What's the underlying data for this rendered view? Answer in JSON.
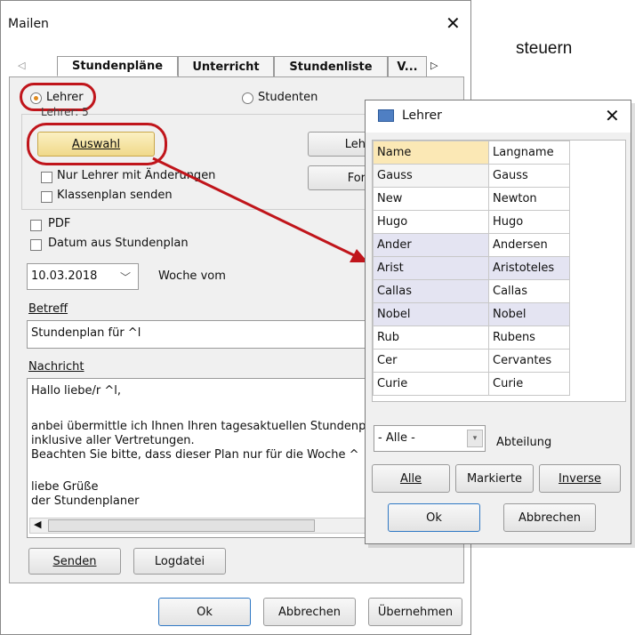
{
  "annotation": {
    "text": "steuern"
  },
  "main_window": {
    "title": "Mailen",
    "tabs": [
      "Stundenpläne",
      "Unterricht",
      "Stundenliste",
      "V..."
    ],
    "radio_teacher": "Lehrer",
    "radio_students": "Studenten",
    "teacher_count": "Lehrer: 5",
    "select_button": "Auswahl",
    "right_button_1": "Leh",
    "right_button_2": "For",
    "cb_only_changes": "Nur Lehrer mit Änderungen",
    "cb_send_class": "Klassenplan senden",
    "cb_pdf": "PDF",
    "cb_date_from_plan": "Datum aus Stundenplan",
    "date_value": "10.03.2018",
    "week_label": "Woche vom",
    "subject_label": "Betreff",
    "subject_value": "Stundenplan für ^l",
    "message_label": "Nachricht",
    "message_lines": [
      "Hallo liebe/r  ^l,",
      "",
      "anbei übermittle ich Ihnen Ihren tagesaktuellen Stundenp",
      "inklusive aller Vertretungen.",
      "Beachten Sie bitte, dass dieser Plan nur für die Woche ^",
      "",
      "liebe Grüße",
      "der Stundenplaner"
    ],
    "send_button": "Senden",
    "logfile_button": "Logdatei",
    "ok_button": "Ok",
    "cancel_button": "Abbrechen",
    "apply_button": "Übernehmen"
  },
  "teacher_dialog": {
    "title": "Lehrer",
    "columns": [
      "Name",
      "Langname"
    ],
    "rows": [
      [
        "Gauss",
        "Gauss"
      ],
      [
        "New",
        "Newton"
      ],
      [
        "Hugo",
        "Hugo"
      ],
      [
        "Ander",
        "Andersen"
      ],
      [
        "Arist",
        "Aristoteles"
      ],
      [
        "Callas",
        "Callas"
      ],
      [
        "Nobel",
        "Nobel"
      ],
      [
        "Rub",
        "Rubens"
      ],
      [
        "Cer",
        "Cervantes"
      ],
      [
        "Curie",
        "Curie"
      ]
    ],
    "filter_value": "- Alle -",
    "filter_label": "Abteilung",
    "all_button": "Alle",
    "marked_button": "Markierte",
    "inverse_button": "Inverse",
    "ok_button": "Ok",
    "cancel_button": "Abbrechen"
  },
  "colors": {
    "highlight_red": "#c0151b",
    "select_button_yellow": "#f6e7a8"
  }
}
